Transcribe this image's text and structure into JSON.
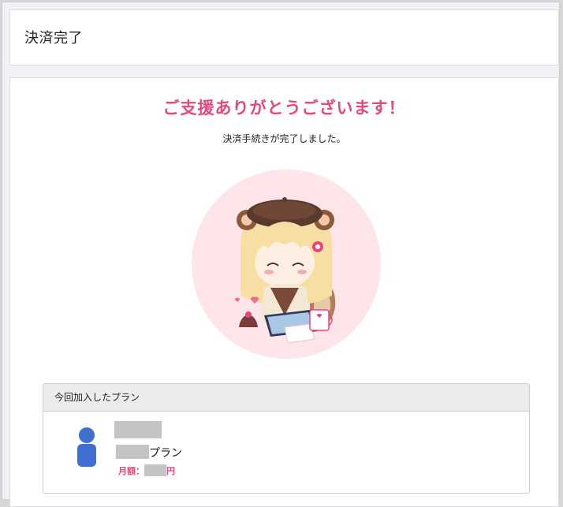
{
  "header": {
    "title": "決済完了"
  },
  "main": {
    "thanks": "ご支援ありがとうございます！",
    "subtext": "決済手続きが完了しました。",
    "illustration_icon": "chibi-squirrel-girl-illustration"
  },
  "plan": {
    "heading": "今回加入したプラン",
    "plan_suffix": "プラン",
    "price_label": "月額：",
    "currency": "円",
    "avatar_icon": "user-icon"
  },
  "colors": {
    "accent_pink": "#e5487d",
    "avatar_blue": "#3f6fd1",
    "illustration_bg": "#fde5e9"
  }
}
